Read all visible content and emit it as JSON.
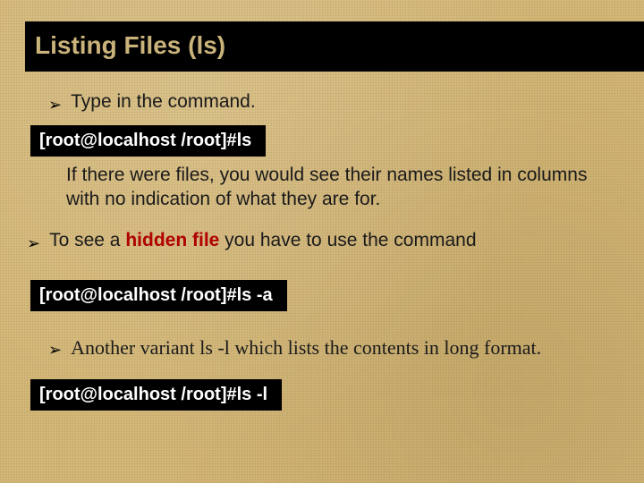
{
  "title": "Listing Files (ls)",
  "bullets": {
    "b1": "Type in the command.",
    "b2_pre": "To see a ",
    "b2_em": "hidden file",
    "b2_post": " you have to use the command",
    "b3": "Another variant ls -l which lists the contents in long format."
  },
  "commands": {
    "c1": "[root@localhost /root]#ls",
    "c2": "[root@localhost /root]#ls -a",
    "c3": "[root@localhost /root]#ls -l"
  },
  "paragraphs": {
    "p1": "If there were files, you would see their names listed in columns with no indication of what they are for."
  },
  "glyphs": {
    "arrow": "➢"
  }
}
